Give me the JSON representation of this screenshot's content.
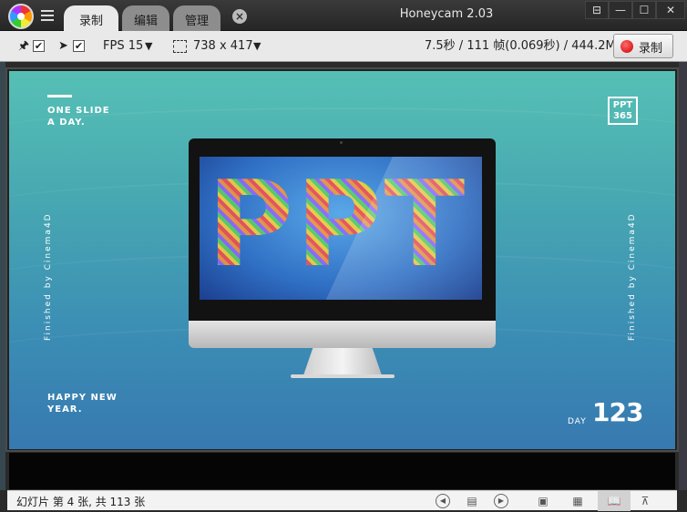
{
  "window": {
    "title": "Honeycam 2.03",
    "tabs": [
      {
        "label": "录制",
        "active": true
      },
      {
        "label": "编辑",
        "active": false
      },
      {
        "label": "管理",
        "active": false
      }
    ],
    "close_tab_glyph": "×",
    "controls": {
      "pin": "⊟",
      "minimize": "—",
      "maximize": "☐",
      "close": "✕"
    }
  },
  "toolbar": {
    "pin_check": "✔",
    "cursor_check": "✔",
    "fps_label": "FPS 15",
    "caret": "▼",
    "size_label": "738 x 417",
    "stats": "7.5秒 / 111 帧(0.069秒) / 444.2MB",
    "record_label": "录制"
  },
  "slide": {
    "top_left_line1": "ONE SLIDE",
    "top_left_line2": "A DAY.",
    "logo_line1": "PPT",
    "logo_line2": "365",
    "vertical_left": "Finished by Cinema4D",
    "vertical_right": "Finished by Cinema4D",
    "screen_text": "PPT",
    "apple_glyph": "",
    "bottom_left_line1": "HAPPY NEW",
    "bottom_left_line2": "YEAR.",
    "day_label": "DAY",
    "day_number": "123"
  },
  "statusbar": {
    "text": "幻灯片 第 4 张, 共 113 张",
    "icons": {
      "prev": "◀",
      "notes": "▤",
      "next": "▶",
      "normal_view": "▣",
      "sorter_view": "▦",
      "reading_view": "📖",
      "slideshow": "⊼"
    }
  },
  "colors": {
    "slide_top": "#56c0b4",
    "slide_bottom": "#3779b0",
    "record_red": "#cc0000",
    "titlebar": "#2e2e2e"
  }
}
